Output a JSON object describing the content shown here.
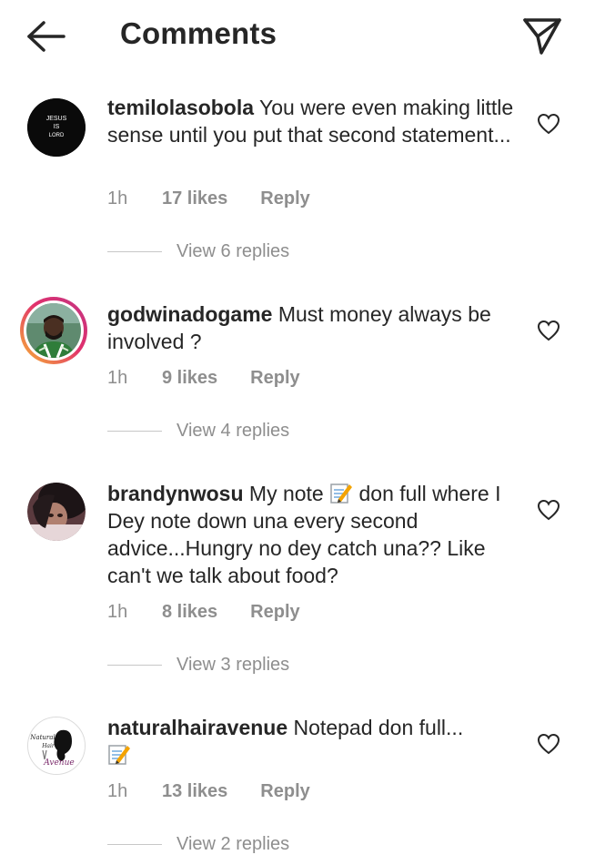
{
  "header": {
    "title": "Comments"
  },
  "comments": [
    {
      "username": "temilolasobola",
      "text": " You were even making little sense until you put that second statement...",
      "time": "1h",
      "likes": "17 likes",
      "reply": "Reply",
      "view_replies": "View 6 replies",
      "avatar": {
        "text_lines": [
          "JESUS",
          "IS",
          "LORD"
        ],
        "color": "#000000"
      }
    },
    {
      "username": "godwinadogame",
      "text": " Must money always be involved ?",
      "time": "1h",
      "likes": "9 likes",
      "reply": "Reply",
      "view_replies": "View 4 replies"
    },
    {
      "username": "brandynwosu",
      "text_before_emoji": " My note ",
      "text_after_emoji": " don full where I Dey note down una every second advice...Hungry no dey catch una?? Like can't we talk about food?",
      "time": "1h",
      "likes": "8 likes",
      "reply": "Reply",
      "view_replies": "View 3 replies"
    },
    {
      "username": "naturalhairavenue",
      "text": " Notepad don full...",
      "time": "1h",
      "likes": "13 likes",
      "reply": "Reply",
      "view_replies": "View 2 replies",
      "avatar": {
        "logo_top": "Natural",
        "logo_mid": "Hair",
        "logo_bottom": "Avenue"
      }
    }
  ],
  "colors": {
    "text": "#262626",
    "secondary": "#8e8e8e",
    "divider": "#c7c7c7",
    "story_ring_start": "#f7b733",
    "story_ring_end": "#c13584"
  },
  "icons": {
    "back": "arrow-left-icon",
    "share": "paper-plane-icon",
    "like": "heart-outline-icon",
    "emoji": "memo-emoji"
  }
}
